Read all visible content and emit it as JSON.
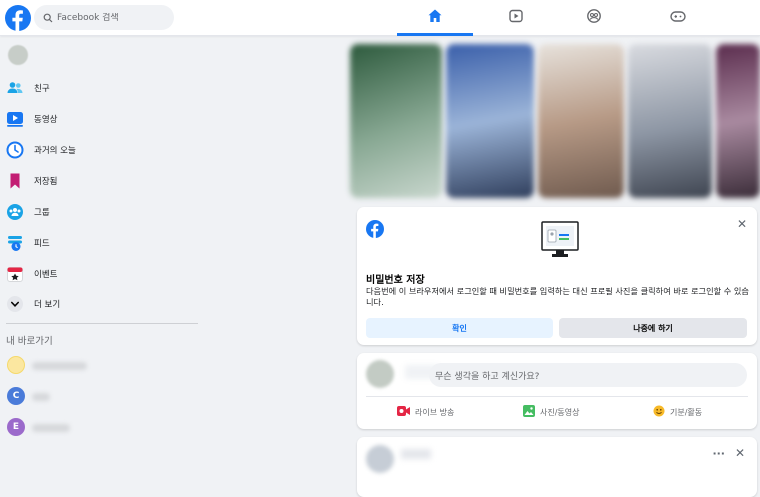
{
  "topbar": {
    "search_placeholder": "Facebook 검색",
    "tabs": [
      {
        "name": "home",
        "icon": "home-icon",
        "active": true
      },
      {
        "name": "watch",
        "icon": "video-icon",
        "active": false
      },
      {
        "name": "groups",
        "icon": "groups-icon",
        "active": false
      },
      {
        "name": "gaming",
        "icon": "gamepad-icon",
        "active": false
      }
    ]
  },
  "sidebar": {
    "items": [
      {
        "label": "친구",
        "icon": "friends-icon"
      },
      {
        "label": "동영상",
        "icon": "video-icon"
      },
      {
        "label": "과거의 오늘",
        "icon": "clock-icon"
      },
      {
        "label": "저장됨",
        "icon": "bookmark-icon"
      },
      {
        "label": "그룹",
        "icon": "groups-icon"
      },
      {
        "label": "피드",
        "icon": "feed-icon"
      },
      {
        "label": "이벤트",
        "icon": "calendar-icon"
      },
      {
        "label": "더 보기",
        "icon": "chevron-down-icon"
      }
    ],
    "shortcuts_title": "내 바로가기",
    "shortcuts": [
      {
        "letter": "",
        "color": "#f5d96b"
      },
      {
        "letter": "C",
        "color": "#4a7bd9"
      },
      {
        "letter": "E",
        "color": "#9b6acb"
      }
    ]
  },
  "password_card": {
    "title": "비밀번호 저장",
    "description": "다음번에 이 브라우저에서 로그인할 때 비밀번호를 입력하는 대신 프로필 사진을 클릭하여 바로 로그인할 수 있습니다.",
    "confirm_label": "확인",
    "later_label": "나중에 하기"
  },
  "composer": {
    "placeholder": "무슨 생각을 하고 계신가요?",
    "actions": [
      {
        "label": "라이브 방송",
        "icon": "live-video-icon",
        "color": "#e42645"
      },
      {
        "label": "사진/동영상",
        "icon": "photo-icon",
        "color": "#45bd62"
      },
      {
        "label": "기분/활동",
        "icon": "smiley-icon",
        "color": "#f7b928"
      }
    ]
  },
  "post": {
    "more_label": "···",
    "close_label": "✕"
  },
  "colors": {
    "brand": "#1877f2",
    "background": "#f0f2f5"
  }
}
